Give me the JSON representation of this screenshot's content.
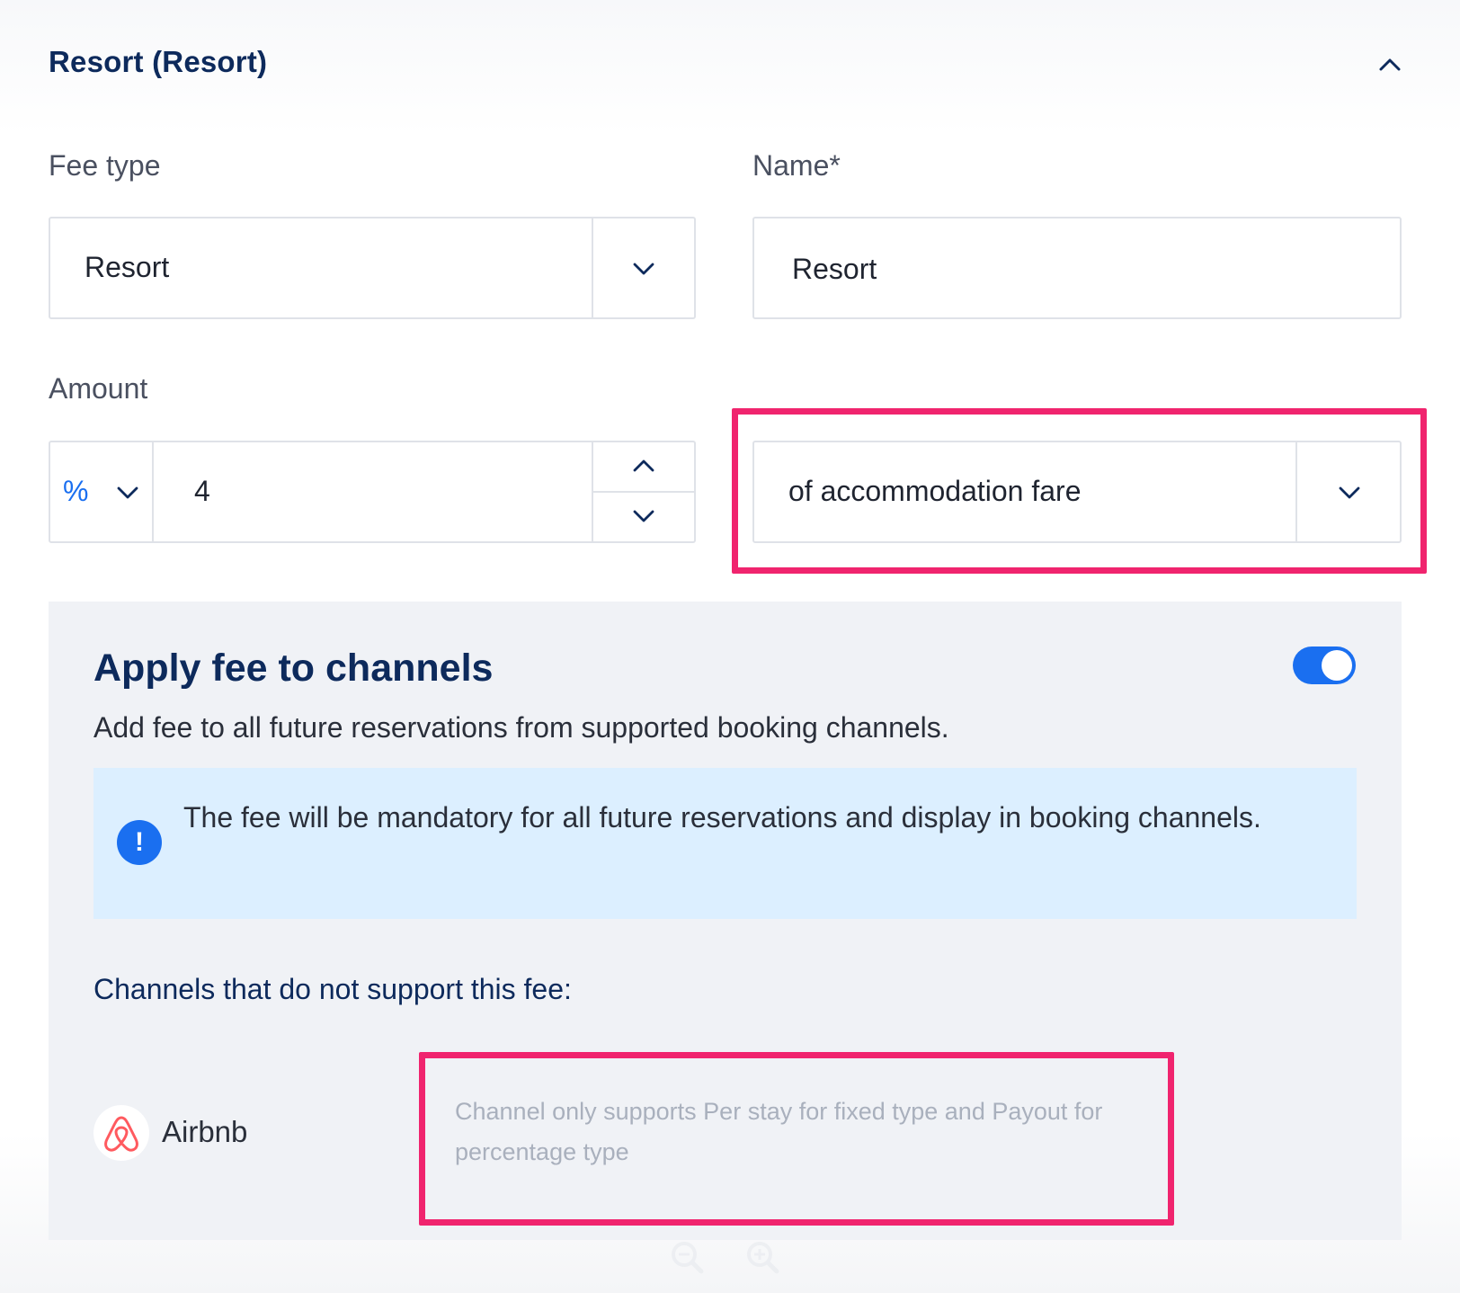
{
  "section": {
    "title": "Resort (Resort)",
    "collapse_icon": "chevron-up-icon"
  },
  "fee_type": {
    "label": "Fee type",
    "value": "Resort",
    "dropdown_icon": "chevron-down-icon"
  },
  "name": {
    "label": "Name*",
    "value": "Resort"
  },
  "amount": {
    "label": "Amount",
    "unit_value": "%",
    "value": "4",
    "increment_icon": "chevron-up-icon",
    "decrement_icon": "chevron-down-icon"
  },
  "basis": {
    "value": "of accommodation fare",
    "dropdown_icon": "chevron-down-icon"
  },
  "channels_panel": {
    "title": "Apply fee to channels",
    "description": "Add fee to all future reservations from supported booking channels.",
    "toggle_on": true,
    "info_text": "The fee will be mandatory for all future reservations and display in booking channels.",
    "info_icon_glyph": "!",
    "unsupported_label": "Channels that do not support this fee:",
    "channels": [
      {
        "name": "Airbnb",
        "icon": "airbnb-icon",
        "note": "Channel only supports Per stay for fixed type and Payout for percentage type"
      }
    ]
  },
  "colors": {
    "accent": "#1a6ff0",
    "highlight": "#f0246e",
    "title": "#0d2a5c",
    "info_bg": "#dcefff",
    "panel_bg": "#f0f2f6"
  },
  "footer": {
    "zoom_out_icon": "zoom-out-icon",
    "zoom_in_icon": "zoom-in-icon"
  }
}
